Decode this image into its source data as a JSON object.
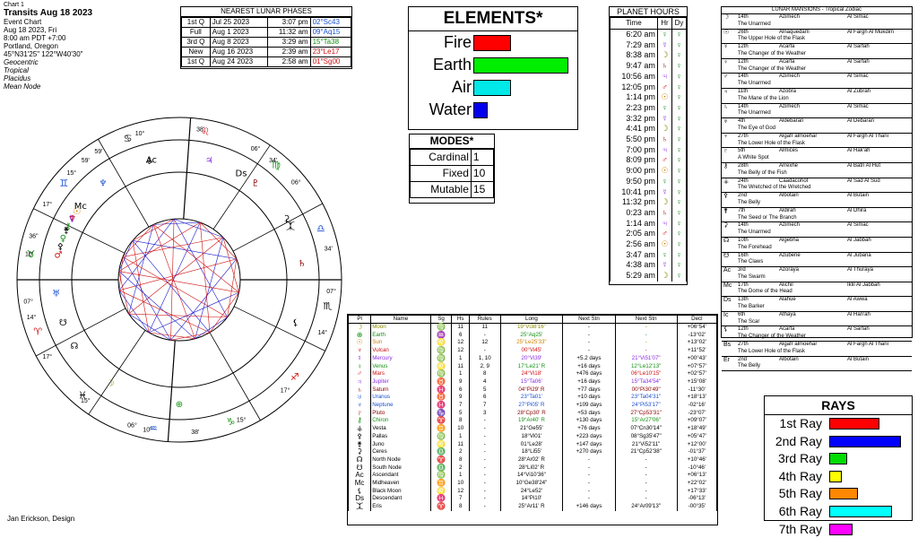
{
  "header": {
    "chart_no": "Chart 1",
    "title": "Transits Aug 18 2023",
    "event": "Event Chart",
    "date": "Aug 18 2023, Fri",
    "time": "8:00 am  PDT +7:00",
    "place": "Portland, Oregon",
    "coords": "45°N31'25\"  122°W40'30\"",
    "settings": [
      "Geocentric",
      "Tropical",
      "Placidus",
      "Mean Node"
    ]
  },
  "lunar": {
    "title": "NEAREST LUNAR PHASES",
    "rows": [
      {
        "phase": "1st Q",
        "date": "Jul 25 2023",
        "time": "3:07 pm",
        "pos": "02°Sc43",
        "color": "#1a4fd0"
      },
      {
        "phase": "Full",
        "date": "Aug 1 2023",
        "time": "11:32 am",
        "pos": "09°Aq15",
        "color": "#1a4fd0"
      },
      {
        "phase": "3rd Q",
        "date": "Aug 8 2023",
        "time": "3:29 am",
        "pos": "15°Ta38",
        "color": "#109010"
      },
      {
        "phase": "New",
        "date": "Aug 16 2023",
        "time": "2:39 am",
        "pos": "23°Le17",
        "color": "#d01010"
      },
      {
        "phase": "1st Q",
        "date": "Aug 24 2023",
        "time": "2:58 am",
        "pos": "01°Sg00",
        "color": "#d01010"
      }
    ]
  },
  "elements": {
    "title": "ELEMENTS*",
    "items": [
      {
        "label": "Fire",
        "value": 8,
        "color": "#ff0000"
      },
      {
        "label": "Earth",
        "value": 20,
        "color": "#00ee00"
      },
      {
        "label": "Air",
        "value": 8,
        "color": "#00e8e8"
      },
      {
        "label": "Water",
        "value": 3,
        "color": "#0000ee"
      }
    ],
    "max": 20
  },
  "modes": {
    "title": "MODES*",
    "items": [
      {
        "label": "Cardinal",
        "value": "1"
      },
      {
        "label": "Fixed",
        "value": "10"
      },
      {
        "label": "Mutable",
        "value": "15"
      }
    ]
  },
  "hours": {
    "title": "PLANET HOURS",
    "cols": [
      "Time",
      "Hr",
      "Dy"
    ],
    "rows": [
      {
        "time": "6:20 am",
        "hr": "♀",
        "hc": "#109010"
      },
      {
        "time": "7:29 am",
        "hr": "☿",
        "hc": "#8a2be2"
      },
      {
        "time": "8:38 am",
        "hr": "☽",
        "hc": "#8a8a00"
      },
      {
        "time": "9:47 am",
        "hr": "♄",
        "hc": "#8b0000"
      },
      {
        "time": "10:56 am",
        "hr": "♃",
        "hc": "#8a2be2"
      },
      {
        "time": "12:05 pm",
        "hr": "♂",
        "hc": "#d01010"
      },
      {
        "time": "1:14 pm",
        "hr": "☉",
        "hc": "#d08000"
      },
      {
        "time": "2:23 pm",
        "hr": "♀",
        "hc": "#109010"
      },
      {
        "time": "3:32 pm",
        "hr": "☿",
        "hc": "#8a2be2"
      },
      {
        "time": "4:41 pm",
        "hr": "☽",
        "hc": "#8a8a00"
      },
      {
        "time": "5:50 pm",
        "hr": "♄",
        "hc": "#8b0000"
      },
      {
        "time": "7:00 pm",
        "hr": "♃",
        "hc": "#8a2be2"
      },
      {
        "time": "8:09 pm",
        "hr": "♂",
        "hc": "#d01010"
      },
      {
        "time": "9:00 pm",
        "hr": "☉",
        "hc": "#d08000"
      },
      {
        "time": "9:50 pm",
        "hr": "♀",
        "hc": "#109010"
      },
      {
        "time": "10:41 pm",
        "hr": "☿",
        "hc": "#8a2be2"
      },
      {
        "time": "11:32 pm",
        "hr": "☽",
        "hc": "#8a8a00"
      },
      {
        "time": "0:23 am",
        "hr": "♄",
        "hc": "#8b0000"
      },
      {
        "time": "1:14 am",
        "hr": "♃",
        "hc": "#8a2be2"
      },
      {
        "time": "2:05 am",
        "hr": "♂",
        "hc": "#d01010"
      },
      {
        "time": "2:56 am",
        "hr": "☉",
        "hc": "#d08000"
      },
      {
        "time": "3:47 am",
        "hr": "♀",
        "hc": "#109010"
      },
      {
        "time": "4:38 am",
        "hr": "☿",
        "hc": "#8a2be2"
      },
      {
        "time": "5:29 am",
        "hr": "☽",
        "hc": "#8a8a00"
      }
    ],
    "day": "♀",
    "day_color": "#109010"
  },
  "mansions": {
    "title": "LUNAR MANSIONS - Tropical Zodiac",
    "rows": [
      {
        "glyph": "☽",
        "deg": "14th",
        "name": "Azimech",
        "arabic": "Al Simac",
        "desc": "The Unarmed"
      },
      {
        "glyph": "☉",
        "deg": "26th",
        "name": "Alnaquedam",
        "arabic": "Al Fargh Al Mukdim",
        "desc": "The Upper Hole of the Flask"
      },
      {
        "glyph": "☿",
        "deg": "12th",
        "name": "Acarfa",
        "arabic": "Al Sarfah",
        "desc": "The Changer of the Weather"
      },
      {
        "glyph": "♀",
        "deg": "12th",
        "name": "Acarfa",
        "arabic": "Al Sarfah",
        "desc": "The Changer of the Weather"
      },
      {
        "glyph": "♂",
        "deg": "14th",
        "name": "Azimech",
        "arabic": "Al Simac",
        "desc": "The Unarmed"
      },
      {
        "glyph": "♃",
        "deg": "11th",
        "name": "Azobra",
        "arabic": "Al Zubrah",
        "desc": "The Mane of the Lion"
      },
      {
        "glyph": "♄",
        "deg": "14th",
        "name": "Azimech",
        "arabic": "Al Simac",
        "desc": "The Unarmed"
      },
      {
        "glyph": "♅",
        "deg": "4th",
        "name": "Aldebaran",
        "arabic": "Al Debaran",
        "desc": "The Eye of God"
      },
      {
        "glyph": "♆",
        "deg": "27th",
        "name": "Algafr almoehar",
        "arabic": "Al Fargh Al Thani",
        "desc": "The Lower Hole of the Flask"
      },
      {
        "glyph": "♇",
        "deg": "5th",
        "name": "Almices",
        "arabic": "Al Hak'ah",
        "desc": "A White Spot"
      },
      {
        "glyph": "⚷",
        "deg": "28th",
        "name": "Arrexhe",
        "arabic": "Al Batn Al Hut",
        "desc": "The Belly of the Fish"
      },
      {
        "glyph": "⚶",
        "deg": "24th",
        "name": "Caadacohot",
        "arabic": "Al Sad Al Sud",
        "desc": "The Wretched of the Wretched"
      },
      {
        "glyph": "⚴",
        "deg": "2nd",
        "name": "Albotain",
        "arabic": "Al Butain",
        "desc": "The Belly"
      },
      {
        "glyph": "⚵",
        "deg": "7th",
        "name": "Aldirah",
        "arabic": "Al Dhira",
        "desc": "The Seed or The Branch"
      },
      {
        "glyph": "⚳",
        "deg": "14th",
        "name": "Azimech",
        "arabic": "Al Simac",
        "desc": "The Unarmed"
      },
      {
        "glyph": "☊",
        "deg": "10th",
        "name": "Algebha",
        "arabic": "Al Jabbah",
        "desc": "The Forehead"
      },
      {
        "glyph": "☋",
        "deg": "16th",
        "name": "Azubene",
        "arabic": "Al Jubana",
        "desc": "The Claws"
      },
      {
        "glyph": "Ac",
        "deg": "3rd",
        "name": "Azoraya",
        "arabic": "Al Thuraya",
        "desc": "The Swarm"
      },
      {
        "glyph": "Mc",
        "deg": "17th",
        "name": "Alichil",
        "arabic": "Iklil Al Jabbah",
        "desc": "The Dome of the Head"
      },
      {
        "glyph": "Ds",
        "deg": "13th",
        "name": "Alahue",
        "arabic": "Al Awwa",
        "desc": "The Barker"
      },
      {
        "glyph": "Ic",
        "deg": "6th",
        "name": "Athaya",
        "arabic": "Al Han'ah",
        "desc": "The Scar"
      },
      {
        "glyph": "⚸",
        "deg": "12th",
        "name": "Acarfa",
        "arabic": "Al Sarfah",
        "desc": "The Changer of the Weather"
      },
      {
        "glyph": "Bs",
        "deg": "27th",
        "name": "Algafr almoehar",
        "arabic": "Al Fargh Al Thani",
        "desc": "The Lower Hole of the Flask"
      },
      {
        "glyph": "Er",
        "deg": "2nd",
        "name": "Albotain",
        "arabic": "Al Butain",
        "desc": "The Belly"
      }
    ]
  },
  "rays": {
    "title": "RAYS",
    "items": [
      {
        "label": "1st Ray",
        "value": 0.7,
        "color": "#ff0000"
      },
      {
        "label": "2nd Ray",
        "value": 1.0,
        "color": "#0000ff"
      },
      {
        "label": "3rd Ray",
        "value": 0.25,
        "color": "#00dd00"
      },
      {
        "label": "4th Ray",
        "value": 0.17,
        "color": "#ffff00"
      },
      {
        "label": "5th Ray",
        "value": 0.4,
        "color": "#ff8800"
      },
      {
        "label": "6th Ray",
        "value": 0.87,
        "color": "#00ffff"
      },
      {
        "label": "7th Ray",
        "value": 0.33,
        "color": "#ff00ff"
      }
    ]
  },
  "positions": {
    "cols": [
      "Pl",
      "Name",
      "Sg",
      "Hs",
      "Rules",
      "Long",
      "Next Stn",
      "Next Stn",
      "Decl"
    ],
    "rows": [
      {
        "g": "☽",
        "name": "Moon",
        "sg": "♍",
        "hs": "11",
        "rules": "11",
        "long": "19°Vi38'16\"",
        "n1": "-",
        "n2": "-",
        "decl": "+06°54'",
        "c": "#8a8a00"
      },
      {
        "g": "⊕",
        "name": "Earth",
        "sg": "♒",
        "hs": "6",
        "rules": "-",
        "long": "25°Aq25'",
        "n1": "-",
        "n2": "-",
        "decl": "-13°02'",
        "c": "#109010"
      },
      {
        "g": "☉",
        "name": "Sun",
        "sg": "♌",
        "hs": "12",
        "rules": "12",
        "long": "25°Le25'33\"",
        "n1": "-",
        "n2": "-",
        "decl": "+13°02'",
        "c": "#d08000"
      },
      {
        "g": "♆",
        "name": "Vulcan",
        "sg": "♍",
        "hs": "12",
        "rules": "-",
        "long": "00°Vi45'",
        "n1": "-",
        "n2": "-",
        "decl": "+11°52'",
        "c": "#d01010"
      },
      {
        "g": "☿",
        "name": "Mercury",
        "sg": "♍",
        "hs": "1",
        "rules": "1, 10",
        "long": "20°Vi39'",
        "n1": "+5.2 days",
        "n2": "21°Vi51'07\"",
        "decl": "+00°43'",
        "c": "#8a2be2"
      },
      {
        "g": "♀",
        "name": "Venus",
        "sg": "♌",
        "hs": "11",
        "rules": "2, 9",
        "long": "17°Le21' R",
        "n1": "+16 days",
        "n2": "12°Le12'13\"",
        "decl": "+07°57'",
        "c": "#109010"
      },
      {
        "g": "♂",
        "name": "Mars",
        "sg": "♍",
        "hs": "1",
        "rules": "8",
        "long": "24°Vi18'",
        "n1": "+476 days",
        "n2": "06°Le10'15\"",
        "decl": "+02°57'",
        "c": "#d01010"
      },
      {
        "g": "♃",
        "name": "Jupiter",
        "sg": "♉",
        "hs": "9",
        "rules": "4",
        "long": "15°Ta06'",
        "n1": "+16 days",
        "n2": "15°Ta34'54\"",
        "decl": "+15°08'",
        "c": "#8a2be2"
      },
      {
        "g": "♄",
        "name": "Saturn",
        "sg": "♓",
        "hs": "6",
        "rules": "5",
        "long": "04°Pi29' R",
        "n1": "+77 days",
        "n2": "00°Pi30'49\"",
        "decl": "-11°30'",
        "c": "#8b0000"
      },
      {
        "g": "♅",
        "name": "Uranus",
        "sg": "♉",
        "hs": "9",
        "rules": "6",
        "long": "23°Ta01'",
        "n1": "+10 days",
        "n2": "23°Ta04'31\"",
        "decl": "+18°13'",
        "c": "#1a4fd0"
      },
      {
        "g": "♆",
        "name": "Neptune",
        "sg": "♓",
        "hs": "7",
        "rules": "7",
        "long": "27°Pi05' R",
        "n1": "+109 days",
        "n2": "24°Pi53'17\"",
        "decl": "-02°16'",
        "c": "#1a4fd0"
      },
      {
        "g": "♇",
        "name": "Pluto",
        "sg": "♑",
        "hs": "5",
        "rules": "3",
        "long": "28°Cp30' R",
        "n1": "+53 days",
        "n2": "27°Cp53'31\"",
        "decl": "-23°07'",
        "c": "#8b0000"
      },
      {
        "g": "⚷",
        "name": "Chiron",
        "sg": "♈",
        "hs": "8",
        "rules": "-",
        "long": "19°Ar40' R",
        "n1": "+130 days",
        "n2": "15°Ar27'06\"",
        "decl": "+09°07'",
        "c": "#109010"
      },
      {
        "g": "⚶",
        "name": "Vesta",
        "sg": "♊",
        "hs": "10",
        "rules": "-",
        "long": "21°Ge55'",
        "n1": "+76 days",
        "n2": "07°Cn30'14\"",
        "decl": "+18°49'",
        "c": "#000000"
      },
      {
        "g": "⚴",
        "name": "Pallas",
        "sg": "♍",
        "hs": "1",
        "rules": "-",
        "long": "18°Vi01'",
        "n1": "+223 days",
        "n2": "08°Sg35'47\"",
        "decl": "+05°47'",
        "c": "#000000"
      },
      {
        "g": "⚵",
        "name": "Juno",
        "sg": "♌",
        "hs": "11",
        "rules": "-",
        "long": "01°Le28'",
        "n1": "+147 days",
        "n2": "21°Vi52'11\"",
        "decl": "+12°00'",
        "c": "#000000"
      },
      {
        "g": "⚳",
        "name": "Ceres",
        "sg": "♎",
        "hs": "2",
        "rules": "-",
        "long": "18°Li55'",
        "n1": "+270 days",
        "n2": "21°Cp52'38\"",
        "decl": "-01°37'",
        "c": "#000000"
      },
      {
        "g": "☊",
        "name": "North Node",
        "sg": "♈",
        "hs": "8",
        "rules": "-",
        "long": "28°Ar02' R",
        "n1": "-",
        "n2": "-",
        "decl": "+10°46'",
        "c": "#000000"
      },
      {
        "g": "☋",
        "name": "South Node",
        "sg": "♎",
        "hs": "2",
        "rules": "-",
        "long": "28°Li02' R",
        "n1": "-",
        "n2": "-",
        "decl": "-10°46'",
        "c": "#000000"
      },
      {
        "g": "Ac",
        "name": "Ascendant",
        "sg": "♍",
        "hs": "1",
        "rules": "-",
        "long": "14°Vi10'36\"",
        "n1": "-",
        "n2": "-",
        "decl": "+06°13'",
        "c": "#000000"
      },
      {
        "g": "Mc",
        "name": "Midheaven",
        "sg": "♊",
        "hs": "10",
        "rules": "-",
        "long": "10°Ge38'24\"",
        "n1": "-",
        "n2": "-",
        "decl": "+22°02'",
        "c": "#000000"
      },
      {
        "g": "⚸",
        "name": "Black Moon",
        "sg": "♌",
        "hs": "12",
        "rules": "-",
        "long": "24°Le52'",
        "n1": "-",
        "n2": "-",
        "decl": "+17°33'",
        "c": "#000000"
      },
      {
        "g": "Ds",
        "name": "Descendant",
        "sg": "♓",
        "hs": "7",
        "rules": "-",
        "long": "14°Pi10'",
        "n1": "-",
        "n2": "-",
        "decl": "-06°13'",
        "c": "#000000"
      },
      {
        "g": "⯰",
        "name": "Eris",
        "sg": "♈",
        "hs": "8",
        "rules": "-",
        "long": "25°Ar11' R",
        "n1": "+146 days",
        "n2": "24°Ar09'13\"",
        "decl": "-00°35'",
        "c": "#000000"
      }
    ]
  },
  "wheel": {
    "outer_labels": [
      {
        "t": "10°",
        "a": "Mc"
      },
      {
        "t": "38'",
        "a": "Mc2"
      },
      {
        "t": "59'",
        "a": "h11"
      },
      {
        "t": "06°",
        "a": "h12a"
      },
      {
        "t": "34'",
        "a": "h12b"
      },
      {
        "t": "07°",
        "a": "asc1"
      },
      {
        "t": "14°",
        "a": "asc2"
      },
      {
        "t": "10'",
        "a": "asc3"
      },
      {
        "t": "36\"",
        "a": "asc4"
      },
      {
        "t": "17°",
        "a": "h2"
      },
      {
        "t": "15°",
        "a": "h3"
      },
      {
        "t": "06°",
        "a": "h4a"
      },
      {
        "t": "38'",
        "a": "h4b"
      },
      {
        "t": "15°",
        "a": "h5"
      },
      {
        "t": "17°",
        "a": "h6"
      },
      {
        "t": "14°",
        "a": "h7"
      },
      {
        "t": "07°",
        "a": "h8"
      },
      {
        "t": "34'",
        "a": "h9"
      },
      {
        "t": "10°",
        "a": "ic1"
      },
      {
        "t": "59'",
        "a": "h9b"
      },
      {
        "t": "15°",
        "a": "h10"
      },
      {
        "t": "17°",
        "a": "h11b"
      },
      {
        "t": "06°",
        "a": "h12c"
      }
    ]
  },
  "footer": {
    "designer": "Jan Erickson, Design"
  }
}
